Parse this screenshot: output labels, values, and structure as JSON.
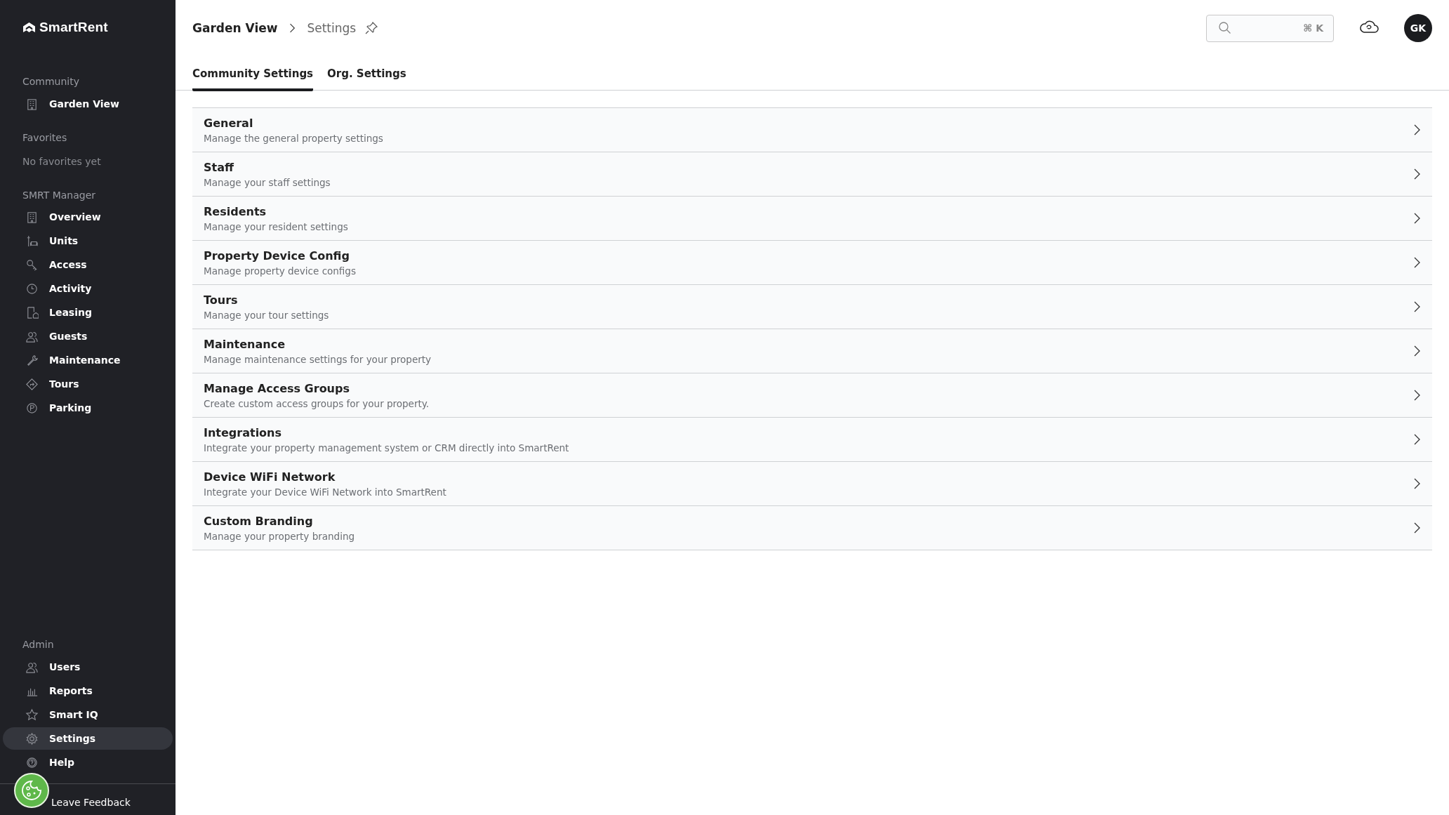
{
  "sidebar": {
    "logo": "SmartRent",
    "sections": [
      {
        "label": "Community",
        "items": [
          {
            "label": "Garden View",
            "selected": false
          }
        ]
      },
      {
        "label": "Favorites",
        "empty_text": "No favorites yet"
      },
      {
        "label": "SMRT Manager",
        "items": [
          {
            "label": "Overview",
            "selected": false
          },
          {
            "label": "Units",
            "selected": false
          },
          {
            "label": "Access",
            "selected": false
          },
          {
            "label": "Activity",
            "selected": false
          },
          {
            "label": "Leasing",
            "selected": false
          },
          {
            "label": "Guests",
            "selected": false
          },
          {
            "label": "Maintenance",
            "selected": false
          },
          {
            "label": "Tours",
            "selected": false
          },
          {
            "label": "Parking",
            "selected": false
          }
        ]
      },
      {
        "label": "Admin",
        "items": [
          {
            "label": "Users",
            "selected": false
          },
          {
            "label": "Reports",
            "selected": false
          },
          {
            "label": "Smart IQ",
            "selected": false
          },
          {
            "label": "Settings",
            "selected": true
          },
          {
            "label": "Help",
            "selected": false
          }
        ]
      }
    ],
    "feedback": "Leave Feedback"
  },
  "breadcrumb": [
    {
      "label": "Garden View"
    },
    {
      "label": "Settings"
    }
  ],
  "search": {
    "shortcut": "⌘ K"
  },
  "avatar": "GK",
  "tabs": [
    {
      "label": "Community Settings",
      "selected": true
    },
    {
      "label": "Org. Settings",
      "selected": false
    }
  ],
  "settings": [
    {
      "title": "General",
      "description": "Manage the general property settings"
    },
    {
      "title": "Staff",
      "description": "Manage your staff settings"
    },
    {
      "title": "Residents",
      "description": "Manage your resident settings"
    },
    {
      "title": "Property Device Config",
      "description": "Manage property device configs"
    },
    {
      "title": "Tours",
      "description": "Manage your tour settings"
    },
    {
      "title": "Maintenance",
      "description": "Manage maintenance settings for your property"
    },
    {
      "title": "Manage Access Groups",
      "description": "Create custom access groups for your property."
    },
    {
      "title": "Integrations",
      "description": "Integrate your property management system or CRM directly into SmartRent"
    },
    {
      "title": "Device WiFi Network",
      "description": "Integrate your Device WiFi Network into SmartRent"
    },
    {
      "title": "Custom Branding",
      "description": "Manage your property branding"
    }
  ]
}
